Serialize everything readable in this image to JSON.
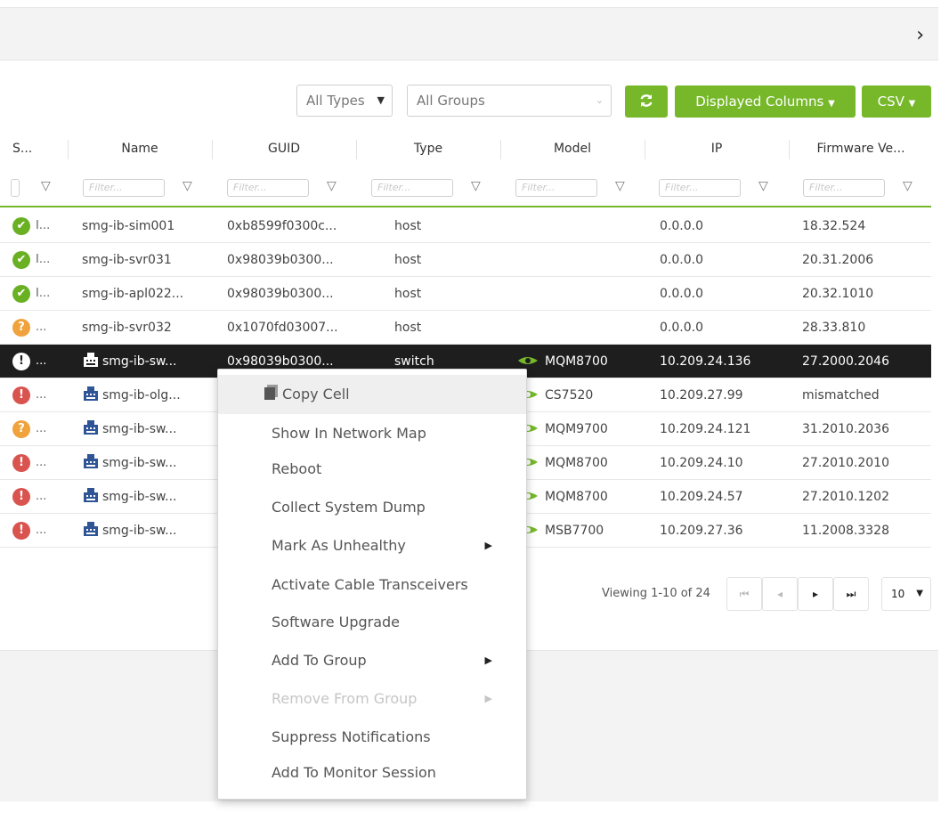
{
  "topbar": {
    "expand_icon": "chevron-right-icon"
  },
  "toolbar": {
    "type_filter": "All Types",
    "group_filter": "All Groups",
    "refresh_icon": "refresh-icon",
    "columns_label": "Displayed Columns",
    "csv_label": "CSV"
  },
  "table": {
    "columns": [
      "S...",
      "Name",
      "GUID",
      "Type",
      "Model",
      "IP",
      "Firmware Ve..."
    ],
    "filter_placeholder": "Filter...",
    "rows": [
      {
        "status": "ok",
        "status_text": "I...",
        "name": "smg-ib-sim001",
        "guid": "0xb8599f0300c...",
        "type": "host",
        "model": "",
        "ip": "0.0.0.0",
        "firmware": "18.32.524"
      },
      {
        "status": "ok",
        "status_text": "I...",
        "name": "smg-ib-svr031",
        "guid": "0x98039b0300...",
        "type": "host",
        "model": "",
        "ip": "0.0.0.0",
        "firmware": "20.31.2006"
      },
      {
        "status": "ok",
        "status_text": "I...",
        "name": "smg-ib-apl022...",
        "guid": "0x98039b0300...",
        "type": "host",
        "model": "",
        "ip": "0.0.0.0",
        "firmware": "20.32.1010"
      },
      {
        "status": "warn",
        "status_text": "...",
        "name": "smg-ib-svr032",
        "guid": "0x1070fd03007...",
        "type": "host",
        "model": "",
        "ip": "0.0.0.0",
        "firmware": "28.33.810"
      },
      {
        "status": "crit",
        "status_text": "...",
        "name": "smg-ib-sw...",
        "guid": "0x98039b0300...",
        "type": "switch",
        "model": "MQM8700",
        "ip": "10.209.24.136",
        "firmware": "27.2000.2046"
      },
      {
        "status": "err",
        "status_text": "...",
        "name": "smg-ib-olg...",
        "guid": "",
        "type": "",
        "model": "CS7520",
        "ip": "10.209.27.99",
        "firmware": "mismatched"
      },
      {
        "status": "warn",
        "status_text": "...",
        "name": "smg-ib-sw...",
        "guid": "",
        "type": "",
        "model": "MQM9700",
        "ip": "10.209.24.121",
        "firmware": "31.2010.2036"
      },
      {
        "status": "err",
        "status_text": "...",
        "name": "smg-ib-sw...",
        "guid": "",
        "type": "",
        "model": "MQM8700",
        "ip": "10.209.24.10",
        "firmware": "27.2010.2010"
      },
      {
        "status": "err",
        "status_text": "...",
        "name": "smg-ib-sw...",
        "guid": "",
        "type": "",
        "model": "MQM8700",
        "ip": "10.209.24.57",
        "firmware": "27.2010.1202"
      },
      {
        "status": "err",
        "status_text": "...",
        "name": "smg-ib-sw...",
        "guid": "",
        "type": "",
        "model": "MSB7700",
        "ip": "10.209.27.36",
        "firmware": "11.2008.3328"
      }
    ]
  },
  "pagination": {
    "viewing": "Viewing 1-10 of 24",
    "page_size": "10"
  },
  "context_menu": {
    "items": [
      {
        "label": "Copy Cell",
        "disabled": false,
        "submenu": false
      },
      {
        "label": "Show In Network Map",
        "disabled": false,
        "submenu": false
      },
      {
        "label": "Reboot",
        "disabled": false,
        "submenu": false
      },
      {
        "label": "Collect System Dump",
        "disabled": false,
        "submenu": false
      },
      {
        "label": "Mark As Unhealthy",
        "disabled": false,
        "submenu": true
      },
      {
        "label": "Activate Cable Transceivers",
        "disabled": false,
        "submenu": false
      },
      {
        "label": "Software Upgrade",
        "disabled": false,
        "submenu": false
      },
      {
        "label": "Add To Group",
        "disabled": false,
        "submenu": true
      },
      {
        "label": "Remove From Group",
        "disabled": true,
        "submenu": true
      },
      {
        "label": "Suppress Notifications",
        "disabled": false,
        "submenu": false
      },
      {
        "label": "Add To Monitor Session",
        "disabled": false,
        "submenu": false
      }
    ]
  },
  "colors": {
    "accent": "#76b82a",
    "ok": "#6ab023",
    "warn": "#f0a23c",
    "err": "#d9534f",
    "selected_row": "#1e1e1e"
  }
}
